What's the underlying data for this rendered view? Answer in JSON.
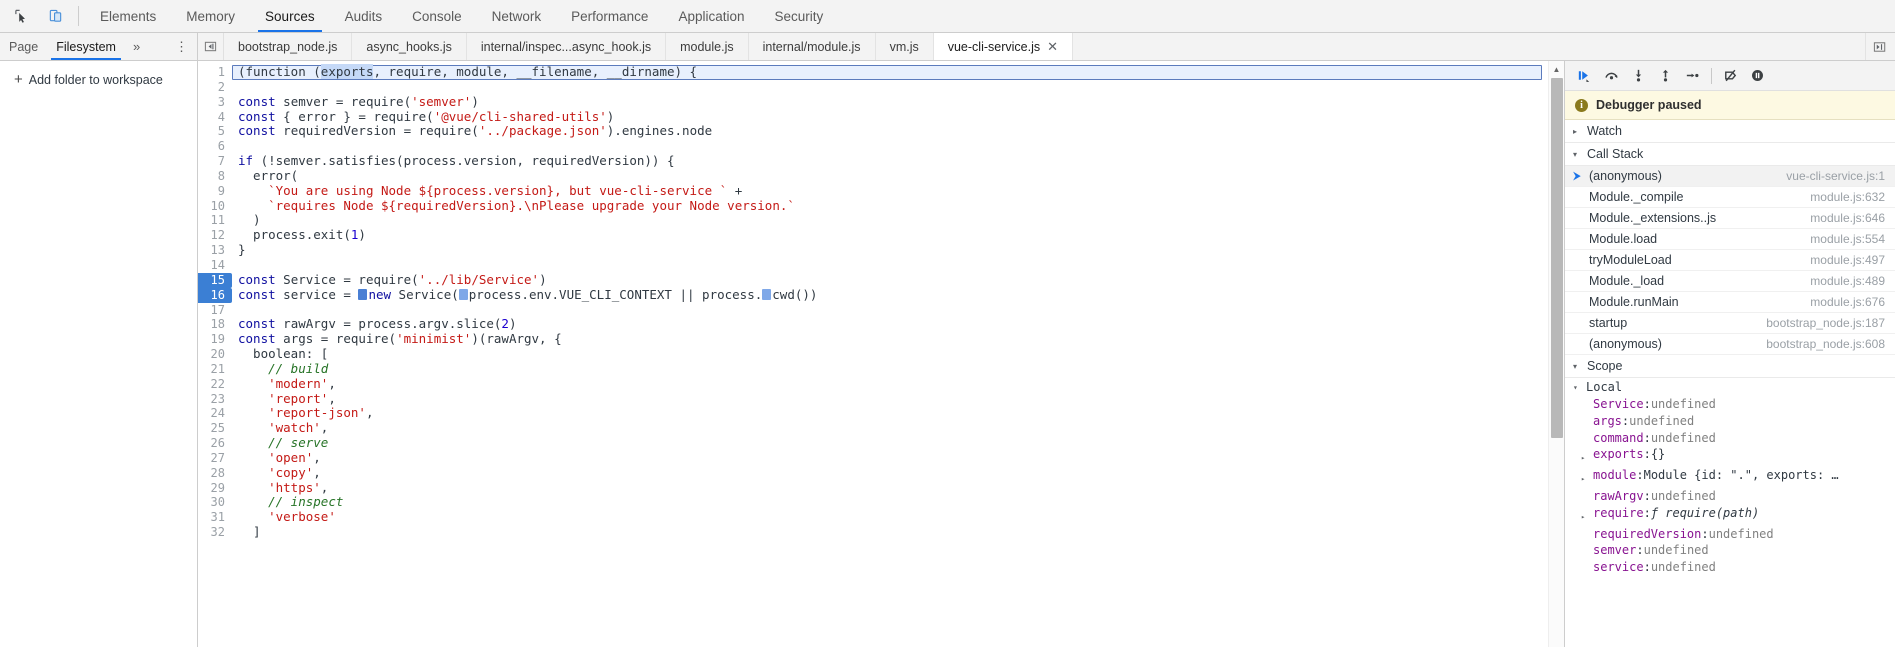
{
  "toolbar": {
    "inspect_icon": "inspect-element-icon",
    "device_icon": "toggle-device-toolbar-icon"
  },
  "main_tabs": [
    {
      "label": "Elements",
      "active": false
    },
    {
      "label": "Memory",
      "active": false
    },
    {
      "label": "Sources",
      "active": true
    },
    {
      "label": "Audits",
      "active": false
    },
    {
      "label": "Console",
      "active": false
    },
    {
      "label": "Network",
      "active": false
    },
    {
      "label": "Performance",
      "active": false
    },
    {
      "label": "Application",
      "active": false
    },
    {
      "label": "Security",
      "active": false
    }
  ],
  "navigator": {
    "tabs": [
      {
        "label": "Page",
        "active": false
      },
      {
        "label": "Filesystem",
        "active": true
      }
    ],
    "more_label": "»",
    "kebab_label": "⋮",
    "add_folder_label": "Add folder to workspace",
    "add_folder_plus": "+"
  },
  "editor_tabs": {
    "prev_icon": "previous-tabs-icon",
    "list_icon": "tab-list-icon",
    "items": [
      {
        "label": "bootstrap_node.js",
        "active": false,
        "closable": false
      },
      {
        "label": "async_hooks.js",
        "active": false,
        "closable": false
      },
      {
        "label": "internal/inspec...async_hook.js",
        "active": false,
        "closable": false
      },
      {
        "label": "module.js",
        "active": false,
        "closable": false
      },
      {
        "label": "internal/module.js",
        "active": false,
        "closable": false
      },
      {
        "label": "vm.js",
        "active": false,
        "closable": false
      },
      {
        "label": "vue-cli-service.js",
        "active": true,
        "closable": true,
        "close_label": "✕"
      }
    ]
  },
  "code": {
    "first_line_selected_token": "exports",
    "lines": [
      {
        "n": 1,
        "bp": false,
        "boxed": true,
        "tokens": [
          {
            "t": "(function ",
            "c": "t-plain"
          },
          {
            "t": "(",
            "c": "t-plain"
          },
          {
            "t": "exports",
            "c": "sel-token"
          },
          {
            "t": ", require, module, __filename, __dirname) {",
            "c": "t-plain"
          }
        ]
      },
      {
        "n": 2,
        "bp": false,
        "tokens": []
      },
      {
        "n": 3,
        "bp": false,
        "tokens": [
          {
            "t": "const",
            "c": "t-key"
          },
          {
            "t": " semver = require(",
            "c": "t-plain"
          },
          {
            "t": "'semver'",
            "c": "t-str"
          },
          {
            "t": ")",
            "c": "t-plain"
          }
        ]
      },
      {
        "n": 4,
        "bp": false,
        "tokens": [
          {
            "t": "const",
            "c": "t-key"
          },
          {
            "t": " { error } = require(",
            "c": "t-plain"
          },
          {
            "t": "'@vue/cli-shared-utils'",
            "c": "t-str"
          },
          {
            "t": ")",
            "c": "t-plain"
          }
        ]
      },
      {
        "n": 5,
        "bp": false,
        "tokens": [
          {
            "t": "const",
            "c": "t-key"
          },
          {
            "t": " requiredVersion = require(",
            "c": "t-plain"
          },
          {
            "t": "'../package.json'",
            "c": "t-str"
          },
          {
            "t": ").engines.node",
            "c": "t-plain"
          }
        ]
      },
      {
        "n": 6,
        "bp": false,
        "tokens": []
      },
      {
        "n": 7,
        "bp": false,
        "tokens": [
          {
            "t": "if",
            "c": "t-key"
          },
          {
            "t": " (!semver.satisfies(process.version, requiredVersion)) {",
            "c": "t-plain"
          }
        ]
      },
      {
        "n": 8,
        "bp": false,
        "tokens": [
          {
            "t": "  error(",
            "c": "t-plain"
          }
        ]
      },
      {
        "n": 9,
        "bp": false,
        "tokens": [
          {
            "t": "    ",
            "c": "t-plain"
          },
          {
            "t": "`You are using Node ${process.version}, but vue-cli-service `",
            "c": "t-str"
          },
          {
            "t": " +",
            "c": "t-plain"
          }
        ]
      },
      {
        "n": 10,
        "bp": false,
        "tokens": [
          {
            "t": "    ",
            "c": "t-plain"
          },
          {
            "t": "`requires Node ${requiredVersion}.\\nPlease upgrade your Node version.`",
            "c": "t-str"
          }
        ]
      },
      {
        "n": 11,
        "bp": false,
        "tokens": [
          {
            "t": "  )",
            "c": "t-plain"
          }
        ]
      },
      {
        "n": 12,
        "bp": false,
        "tokens": [
          {
            "t": "  process.exit(",
            "c": "t-plain"
          },
          {
            "t": "1",
            "c": "t-num"
          },
          {
            "t": ")",
            "c": "t-plain"
          }
        ]
      },
      {
        "n": 13,
        "bp": false,
        "tokens": [
          {
            "t": "}",
            "c": "t-plain"
          }
        ]
      },
      {
        "n": 14,
        "bp": false,
        "tokens": []
      },
      {
        "n": 15,
        "bp": true,
        "tokens": [
          {
            "t": "const",
            "c": "t-key"
          },
          {
            "t": " Service = require(",
            "c": "t-plain"
          },
          {
            "t": "'../lib/Service'",
            "c": "t-str"
          },
          {
            "t": ")",
            "c": "t-plain"
          }
        ]
      },
      {
        "n": 16,
        "bp": true,
        "inline_bp": true,
        "tokens": [
          {
            "t": "const",
            "c": "t-key"
          },
          {
            "t": " service = ",
            "c": "t-plain"
          },
          {
            "t": "__BP_DARK__",
            "c": "marker"
          },
          {
            "t": "new",
            "c": "t-key"
          },
          {
            "t": " Service(",
            "c": "t-plain"
          },
          {
            "t": "__BP_LIGHT__",
            "c": "marker"
          },
          {
            "t": "process.env.VUE_CLI_CONTEXT ",
            "c": "t-plain"
          },
          {
            "t": "||",
            "c": "t-plain"
          },
          {
            "t": " process.",
            "c": "t-plain"
          },
          {
            "t": "__BP_LIGHT__",
            "c": "marker"
          },
          {
            "t": "cwd())",
            "c": "t-plain"
          }
        ]
      },
      {
        "n": 17,
        "bp": false,
        "tokens": []
      },
      {
        "n": 18,
        "bp": false,
        "tokens": [
          {
            "t": "const",
            "c": "t-key"
          },
          {
            "t": " rawArgv = process.argv.slice(",
            "c": "t-plain"
          },
          {
            "t": "2",
            "c": "t-num"
          },
          {
            "t": ")",
            "c": "t-plain"
          }
        ]
      },
      {
        "n": 19,
        "bp": false,
        "tokens": [
          {
            "t": "const",
            "c": "t-key"
          },
          {
            "t": " args = require(",
            "c": "t-plain"
          },
          {
            "t": "'minimist'",
            "c": "t-str"
          },
          {
            "t": ")(rawArgv, {",
            "c": "t-plain"
          }
        ]
      },
      {
        "n": 20,
        "bp": false,
        "tokens": [
          {
            "t": "  boolean: [",
            "c": "t-plain"
          }
        ]
      },
      {
        "n": 21,
        "bp": false,
        "tokens": [
          {
            "t": "    ",
            "c": "t-plain"
          },
          {
            "t": "// build",
            "c": "t-com"
          }
        ]
      },
      {
        "n": 22,
        "bp": false,
        "tokens": [
          {
            "t": "    ",
            "c": "t-plain"
          },
          {
            "t": "'modern'",
            "c": "t-str"
          },
          {
            "t": ",",
            "c": "t-plain"
          }
        ]
      },
      {
        "n": 23,
        "bp": false,
        "tokens": [
          {
            "t": "    ",
            "c": "t-plain"
          },
          {
            "t": "'report'",
            "c": "t-str"
          },
          {
            "t": ",",
            "c": "t-plain"
          }
        ]
      },
      {
        "n": 24,
        "bp": false,
        "tokens": [
          {
            "t": "    ",
            "c": "t-plain"
          },
          {
            "t": "'report-json'",
            "c": "t-str"
          },
          {
            "t": ",",
            "c": "t-plain"
          }
        ]
      },
      {
        "n": 25,
        "bp": false,
        "tokens": [
          {
            "t": "    ",
            "c": "t-plain"
          },
          {
            "t": "'watch'",
            "c": "t-str"
          },
          {
            "t": ",",
            "c": "t-plain"
          }
        ]
      },
      {
        "n": 26,
        "bp": false,
        "tokens": [
          {
            "t": "    ",
            "c": "t-plain"
          },
          {
            "t": "// serve",
            "c": "t-com"
          }
        ]
      },
      {
        "n": 27,
        "bp": false,
        "tokens": [
          {
            "t": "    ",
            "c": "t-plain"
          },
          {
            "t": "'open'",
            "c": "t-str"
          },
          {
            "t": ",",
            "c": "t-plain"
          }
        ]
      },
      {
        "n": 28,
        "bp": false,
        "tokens": [
          {
            "t": "    ",
            "c": "t-plain"
          },
          {
            "t": "'copy'",
            "c": "t-str"
          },
          {
            "t": ",",
            "c": "t-plain"
          }
        ]
      },
      {
        "n": 29,
        "bp": false,
        "tokens": [
          {
            "t": "    ",
            "c": "t-plain"
          },
          {
            "t": "'https'",
            "c": "t-str"
          },
          {
            "t": ",",
            "c": "t-plain"
          }
        ]
      },
      {
        "n": 30,
        "bp": false,
        "tokens": [
          {
            "t": "    ",
            "c": "t-plain"
          },
          {
            "t": "// inspect",
            "c": "t-com"
          }
        ]
      },
      {
        "n": 31,
        "bp": false,
        "tokens": [
          {
            "t": "    ",
            "c": "t-plain"
          },
          {
            "t": "'verbose'",
            "c": "t-str"
          }
        ]
      },
      {
        "n": 32,
        "bp": false,
        "tokens": [
          {
            "t": "  ]",
            "c": "t-plain"
          }
        ]
      }
    ]
  },
  "debugger": {
    "controls": [
      {
        "name": "resume-script-execution",
        "icon": "resume-icon"
      },
      {
        "name": "step-over-next-function-call",
        "icon": "step-over-icon"
      },
      {
        "name": "step-into-next-function-call",
        "icon": "step-into-icon"
      },
      {
        "name": "step-out-of-current-function",
        "icon": "step-out-icon"
      },
      {
        "name": "step",
        "icon": "step-icon"
      },
      {
        "name": "deactivate-breakpoints",
        "icon": "deactivate-breakpoints-icon"
      },
      {
        "name": "pause-on-exceptions",
        "icon": "pause-on-exceptions-icon"
      }
    ],
    "paused_banner": {
      "text": "Debugger paused",
      "icon_char": "i"
    },
    "watch": {
      "label": "Watch",
      "expanded": false,
      "tri": "▸"
    },
    "call_stack": {
      "label": "Call Stack",
      "expanded": true,
      "tri": "▾",
      "frames": [
        {
          "fn": "(anonymous)",
          "loc": "vue-cli-service.js:1",
          "selected": true,
          "mark": "⮞"
        },
        {
          "fn": "Module._compile",
          "loc": "module.js:632",
          "selected": false,
          "mark": ""
        },
        {
          "fn": "Module._extensions..js",
          "loc": "module.js:646",
          "selected": false,
          "mark": ""
        },
        {
          "fn": "Module.load",
          "loc": "module.js:554",
          "selected": false,
          "mark": ""
        },
        {
          "fn": "tryModuleLoad",
          "loc": "module.js:497",
          "selected": false,
          "mark": ""
        },
        {
          "fn": "Module._load",
          "loc": "module.js:489",
          "selected": false,
          "mark": ""
        },
        {
          "fn": "Module.runMain",
          "loc": "module.js:676",
          "selected": false,
          "mark": ""
        },
        {
          "fn": "startup",
          "loc": "bootstrap_node.js:187",
          "selected": false,
          "mark": ""
        },
        {
          "fn": "(anonymous)",
          "loc": "bootstrap_node.js:608",
          "selected": false,
          "mark": ""
        }
      ]
    },
    "scope": {
      "label": "Scope",
      "expanded": true,
      "tri": "▾",
      "local_label": "Local",
      "local_tri": "▾",
      "vars": [
        {
          "tri": "",
          "name": "Service",
          "sep": ": ",
          "value": "undefined",
          "vclass": "sc-val"
        },
        {
          "tri": "",
          "name": "args",
          "sep": ": ",
          "value": "undefined",
          "vclass": "sc-val"
        },
        {
          "tri": "",
          "name": "command",
          "sep": ": ",
          "value": "undefined",
          "vclass": "sc-val"
        },
        {
          "tri": "▸",
          "name": "exports",
          "sep": ": ",
          "value": "{}",
          "vclass": "sc-val-obj"
        },
        {
          "tri": "▸",
          "name": "module",
          "sep": ": ",
          "value": "Module {id: \".\", exports: …",
          "vclass": "sc-val-obj"
        },
        {
          "tri": "",
          "name": "rawArgv",
          "sep": ": ",
          "value": "undefined",
          "vclass": "sc-val"
        },
        {
          "tri": "▸",
          "name": "require",
          "sep": ": ",
          "value": "ƒ require(path)",
          "vclass": "sc-fn"
        },
        {
          "tri": "",
          "name": "requiredVersion",
          "sep": ": ",
          "value": "undefined",
          "vclass": "sc-val"
        },
        {
          "tri": "",
          "name": "semver",
          "sep": ": ",
          "value": "undefined",
          "vclass": "sc-val"
        },
        {
          "tri": "",
          "name": "service",
          "sep": ": ",
          "value": "undefined",
          "vclass": "sc-val"
        }
      ]
    }
  },
  "colors": {
    "accent": "#1a73e8",
    "breakpoint": "#3b7fd4",
    "paused_bg": "#fdf9e2",
    "string": "#c41a16",
    "keyword": "#0f0fa0",
    "comment": "#267326",
    "number": "#1c00cf",
    "property": "#881391"
  }
}
